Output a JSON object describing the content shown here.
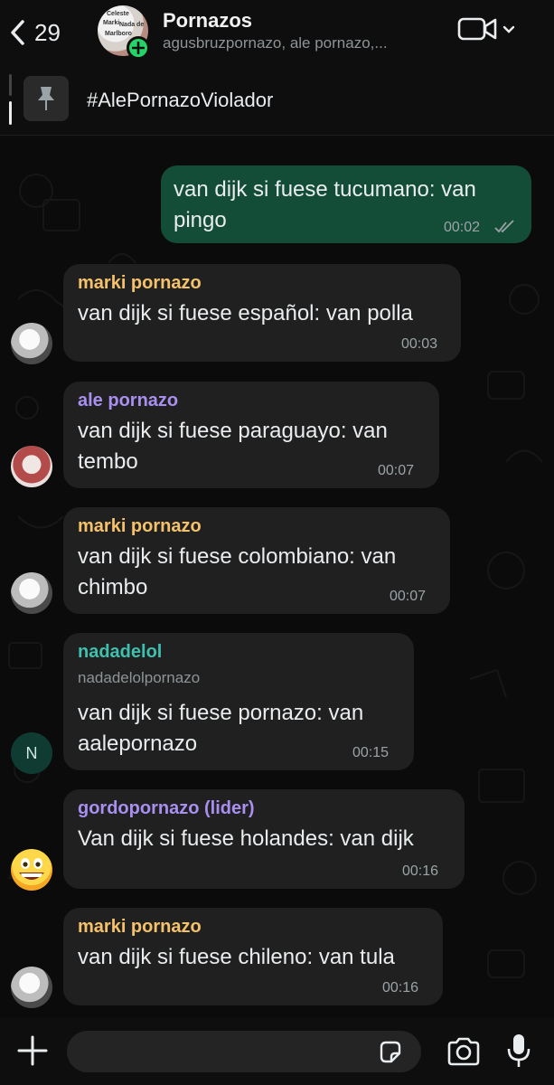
{
  "header": {
    "back_count": "29",
    "title": "Pornazos",
    "subtitle": "agusbruzpornazo, ale pornazo,...",
    "avatar_lettering": [
      "Celeste",
      "Marki",
      "Nada de",
      "Marlboro"
    ]
  },
  "pinned": {
    "text": "#AlePornazoViolador"
  },
  "messages": [
    {
      "direction": "out",
      "text": "van dijk si fuese tucumano: van pingo",
      "time": "00:02",
      "status": "read"
    },
    {
      "direction": "in",
      "sender": "marki pornazo",
      "sender_color": "#f5c26b",
      "text": "van dijk si fuese español: van polla",
      "time": "00:03",
      "avatar": "gray-photo"
    },
    {
      "direction": "in",
      "sender": "ale pornazo",
      "sender_color": "#a88ff0",
      "text": "van dijk si fuese paraguayo: van tembo",
      "time": "00:07",
      "avatar": "red-photo"
    },
    {
      "direction": "in",
      "sender": "marki pornazo",
      "sender_color": "#f5c26b",
      "text": "van dijk si fuese colombiano: van chimbo",
      "time": "00:07",
      "avatar": "gray-photo"
    },
    {
      "direction": "in",
      "sender": "nadadelol",
      "sender_color": "#3fbfae",
      "handle": "nadadelolpornazo",
      "text": "van dijk si fuese pornazo: van aalepornazo",
      "time": "00:15",
      "avatar": "N"
    },
    {
      "direction": "in",
      "sender": "gordopornazo (lider)",
      "sender_color": "#a88ff0",
      "text": "Van dijk si fuese holandes: van dijk",
      "time": "00:16",
      "avatar": "grin-emoji"
    },
    {
      "direction": "in",
      "sender": "marki pornazo",
      "sender_color": "#f5c26b",
      "text": "van dijk si fuese chileno: van tula",
      "time": "00:16",
      "avatar": "gray-photo"
    }
  ],
  "colors": {
    "outgoing_bubble": "#144d37",
    "incoming_bubble": "#202020",
    "accent_green": "#25d366"
  },
  "icons": {
    "back": "chevron-left-icon",
    "video": "video-camera-icon",
    "dropdown": "chevron-down-icon",
    "pin": "pin-icon",
    "attach": "plus-icon",
    "sticker": "sticker-icon",
    "camera": "camera-icon",
    "mic": "microphone-icon"
  }
}
